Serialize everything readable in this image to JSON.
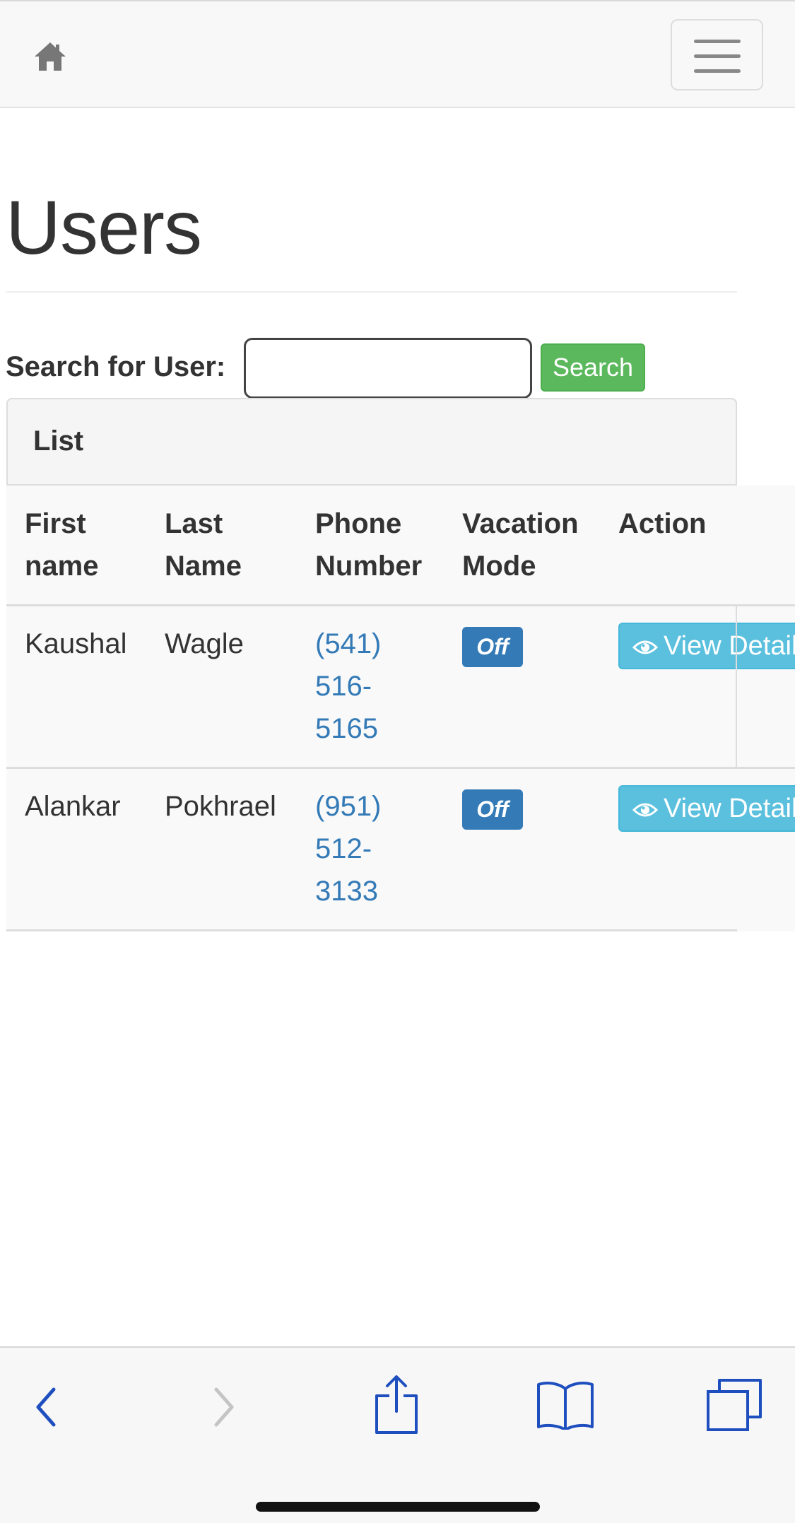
{
  "navbar": {
    "home_icon": "home-icon",
    "menu_icon": "hamburger-menu-icon"
  },
  "page": {
    "title": "Users"
  },
  "search": {
    "label": "Search for User:",
    "value": "",
    "placeholder": "",
    "button_label": "Search"
  },
  "panel": {
    "heading": "List"
  },
  "table": {
    "headers": {
      "first_name": [
        "First",
        "name"
      ],
      "last_name": [
        "Last",
        "Name"
      ],
      "phone": [
        "Phone",
        "Number"
      ],
      "vacation": [
        "Vacation",
        "Mode"
      ],
      "action": [
        "Action"
      ]
    },
    "rows": [
      {
        "first_name": "Kaushal",
        "last_name": "Wagle",
        "phone_lines": [
          "(541)",
          "516-",
          "5165"
        ],
        "vacation": "Off",
        "action_label": "View Details"
      },
      {
        "first_name": "Alankar",
        "last_name": "Pokhrael",
        "phone_lines": [
          "(951)",
          "512-",
          "3133"
        ],
        "vacation": "Off",
        "action_label": "View Details"
      }
    ]
  },
  "browser_bar": {
    "icons": [
      "back-icon",
      "forward-icon",
      "share-icon",
      "bookmarks-icon",
      "tabs-icon"
    ]
  },
  "colors": {
    "navbar_bg": "#f8f8f8",
    "search_button": "#5cb85c",
    "badge": "#337ab7",
    "view_button": "#5bc0de",
    "phone_link": "#337ab7",
    "browser_icon": "#1f4fbf"
  }
}
